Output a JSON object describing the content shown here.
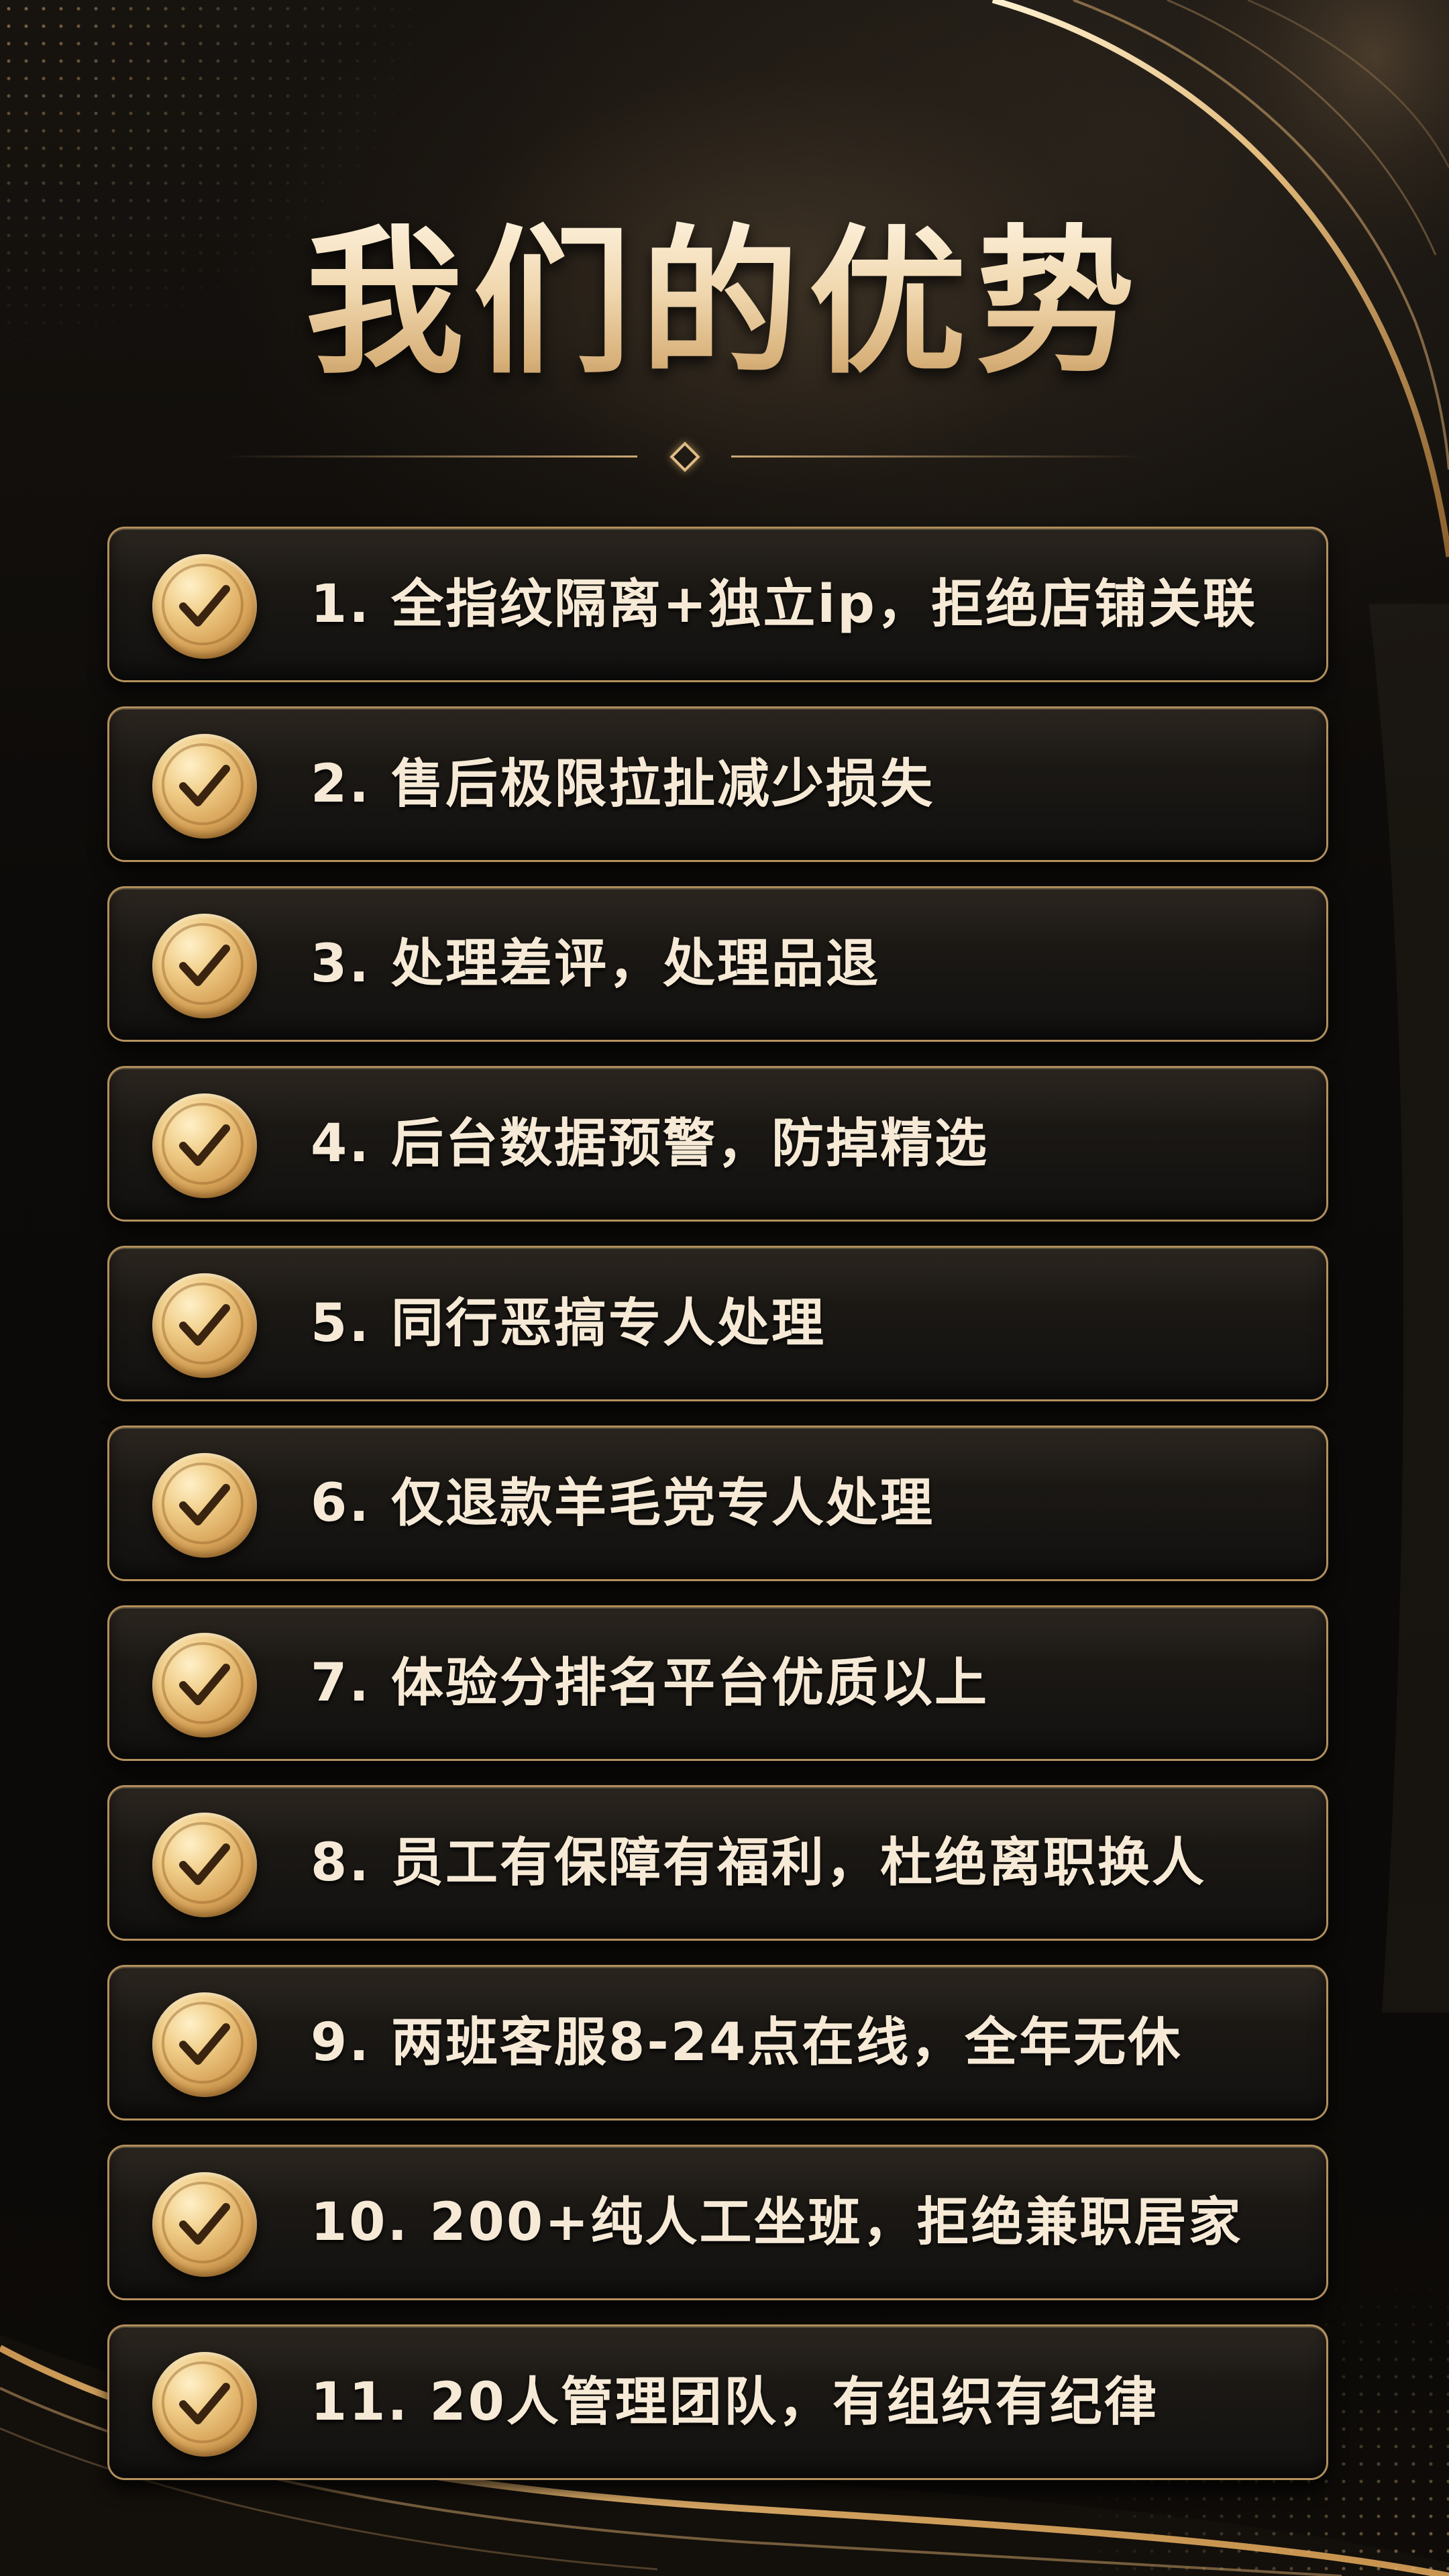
{
  "title": "我们的优势",
  "colors": {
    "gold": "#d9b27c",
    "title_gold": "#f0d7ae",
    "background": "#0c0a08",
    "card_border": "#cda569",
    "text": "#f6ead6"
  },
  "advantages": [
    {
      "label": "1. 全指纹隔离+独立ip，拒绝店铺关联",
      "icon": "check-circle-icon"
    },
    {
      "label": "2. 售后极限拉扯减少损失",
      "icon": "check-circle-icon"
    },
    {
      "label": "3. 处理差评，处理品退",
      "icon": "check-circle-icon"
    },
    {
      "label": "4. 后台数据预警，防掉精选",
      "icon": "check-circle-icon"
    },
    {
      "label": "5. 同行恶搞专人处理",
      "icon": "check-circle-icon"
    },
    {
      "label": "6. 仅退款羊毛党专人处理",
      "icon": "check-circle-icon"
    },
    {
      "label": "7. 体验分排名平台优质以上",
      "icon": "check-circle-icon"
    },
    {
      "label": "8. 员工有保障有福利，杜绝离职换人",
      "icon": "check-circle-icon"
    },
    {
      "label": "9. 两班客服8-24点在线，全年无休",
      "icon": "check-circle-icon"
    },
    {
      "label": "10. 200+纯人工坐班，拒绝兼职居家",
      "icon": "check-circle-icon"
    },
    {
      "label": "11. 20人管理团队，有组织有纪律",
      "icon": "check-circle-icon"
    }
  ]
}
